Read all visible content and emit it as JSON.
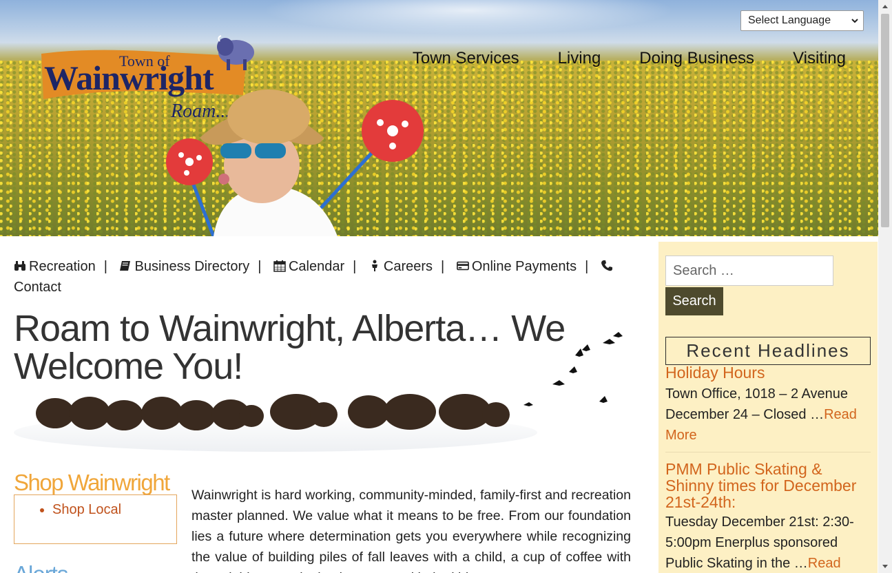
{
  "header": {
    "logo_text_small": "Town of",
    "logo_text_main": "Wainwright",
    "logo_tagline": "Roam...",
    "language_select": "Select Language",
    "nav": [
      "Town Services",
      "Living",
      "Doing Business",
      "Visiting"
    ]
  },
  "quick_links": [
    {
      "icon": "binoculars-icon",
      "label": "Recreation"
    },
    {
      "icon": "book-icon",
      "label": "Business Directory"
    },
    {
      "icon": "calendar-icon",
      "label": "Calendar"
    },
    {
      "icon": "person-icon",
      "label": "Careers"
    },
    {
      "icon": "credit-card-icon",
      "label": "Online Payments"
    },
    {
      "icon": "phone-icon",
      "label": "Contact"
    }
  ],
  "main": {
    "title": "Roam to Wainwright, Alberta… We Welcome You!",
    "intro": "Wainwright is hard working, community-minded, family-first and recreation master planned. We value what it means to be free. From our foundation lies a future where determination gets you everywhere while recognizing the value of building piles of fall leaves with a child, a cup of coffee with the neighbour, and a hockey game with the kids."
  },
  "shop": {
    "title": "Shop Wainwright",
    "items": [
      "Shop Local"
    ]
  },
  "alerts": {
    "title": "Alerts"
  },
  "sidebar": {
    "search_placeholder": "Search …",
    "search_button": "Search",
    "headlines_title": "Recent Headlines",
    "headlines": [
      {
        "title": "Holiday Hours",
        "excerpt": "Town Office, 1018 – 2 Avenue December 24 – Closed …",
        "more": "Read More"
      },
      {
        "title": "PMM Public Skating & Shinny times for December 21st-24th:",
        "excerpt": "Tuesday December 21st: 2:30-5:00pm Enerplus sponsored Public Skating in the …",
        "more": "Read More"
      }
    ]
  },
  "colors": {
    "accent_orange": "#d2651d",
    "shop_orange": "#f0a63a",
    "alerts_blue": "#6aa7d8",
    "sidebar_bg": "#fdf0c4",
    "search_button_bg": "#4e4a2d"
  }
}
